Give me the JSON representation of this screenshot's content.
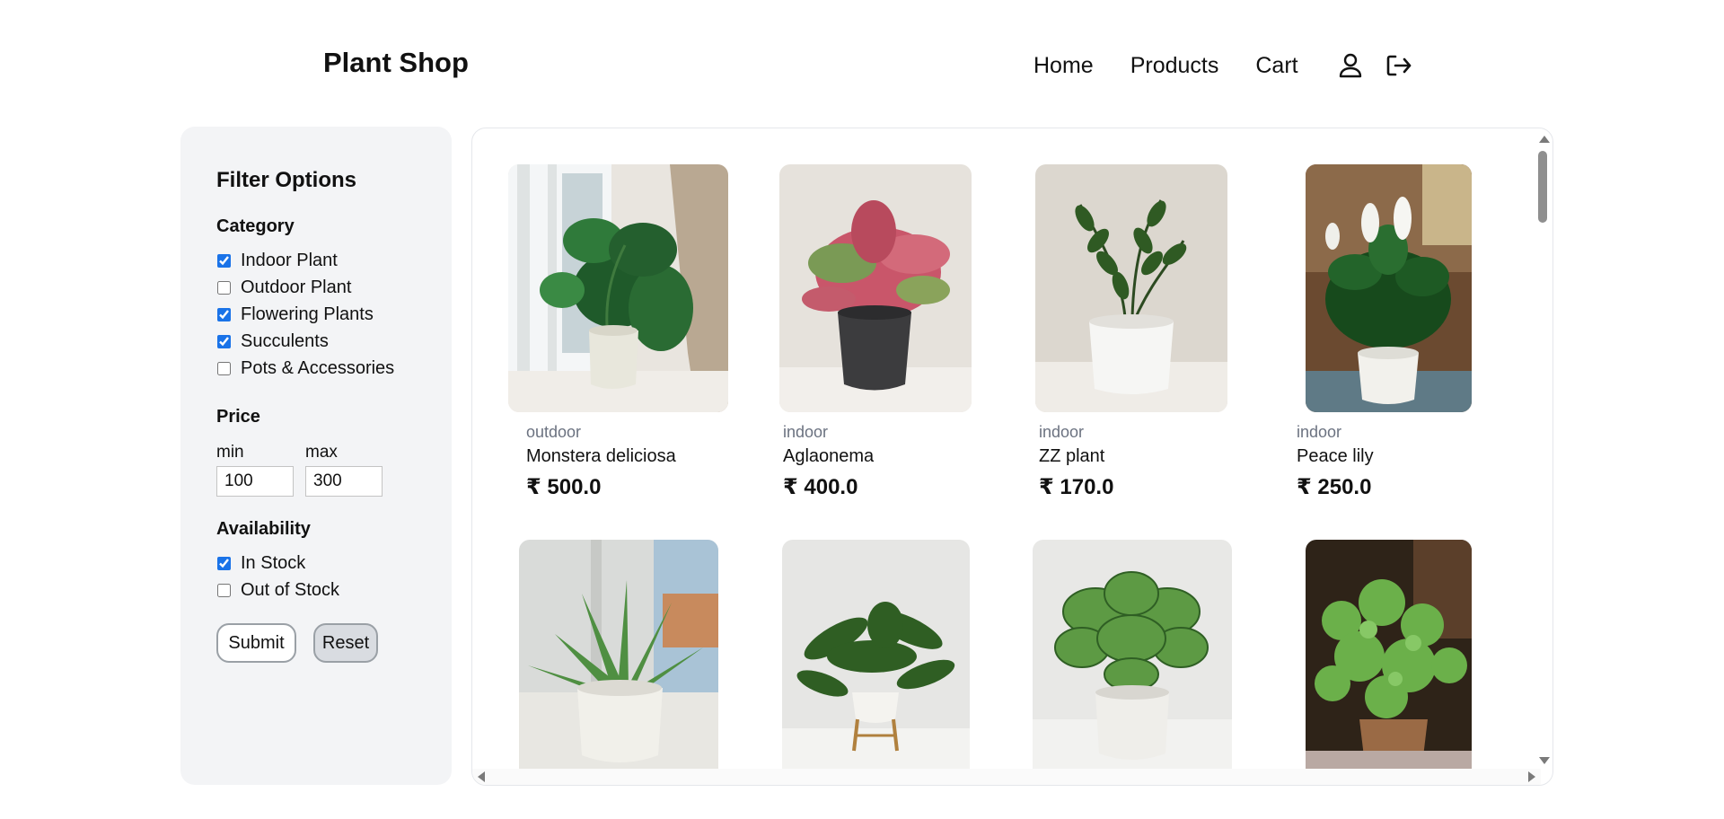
{
  "header": {
    "brand": "Plant Shop",
    "nav": [
      "Home",
      "Products",
      "Cart"
    ],
    "icons": [
      "user-icon",
      "logout-icon"
    ]
  },
  "filters": {
    "title": "Filter Options",
    "category": {
      "title": "Category",
      "options": [
        {
          "label": "Indoor Plant",
          "checked": true
        },
        {
          "label": "Outdoor Plant",
          "checked": false
        },
        {
          "label": "Flowering Plants",
          "checked": true
        },
        {
          "label": "Succulents",
          "checked": true
        },
        {
          "label": "Pots & Accessories",
          "checked": false
        }
      ]
    },
    "price": {
      "title": "Price",
      "min_label": "min",
      "max_label": "max",
      "min_value": "100",
      "max_value": "300"
    },
    "availability": {
      "title": "Availability",
      "options": [
        {
          "label": "In Stock",
          "checked": true
        },
        {
          "label": "Out of Stock",
          "checked": false
        }
      ]
    },
    "submit_label": "Submit",
    "reset_label": "Reset"
  },
  "products": [
    {
      "category": "outdoor",
      "name": "Monstera deliciosa",
      "price": "₹ 500.0"
    },
    {
      "category": "indoor",
      "name": "Aglaonema",
      "price": "₹ 400.0"
    },
    {
      "category": "indoor",
      "name": "ZZ plant",
      "price": "₹ 170.0"
    },
    {
      "category": "indoor",
      "name": "Peace lily",
      "price": "₹ 250.0"
    },
    {
      "category": "",
      "name": "",
      "price": ""
    },
    {
      "category": "",
      "name": "",
      "price": ""
    },
    {
      "category": "",
      "name": "",
      "price": ""
    },
    {
      "category": "",
      "name": "",
      "price": ""
    }
  ],
  "colors": {
    "sidebar_bg": "#f3f4f6",
    "checkbox_accent": "#1a73e8",
    "reset_bg": "#d9dce1"
  }
}
